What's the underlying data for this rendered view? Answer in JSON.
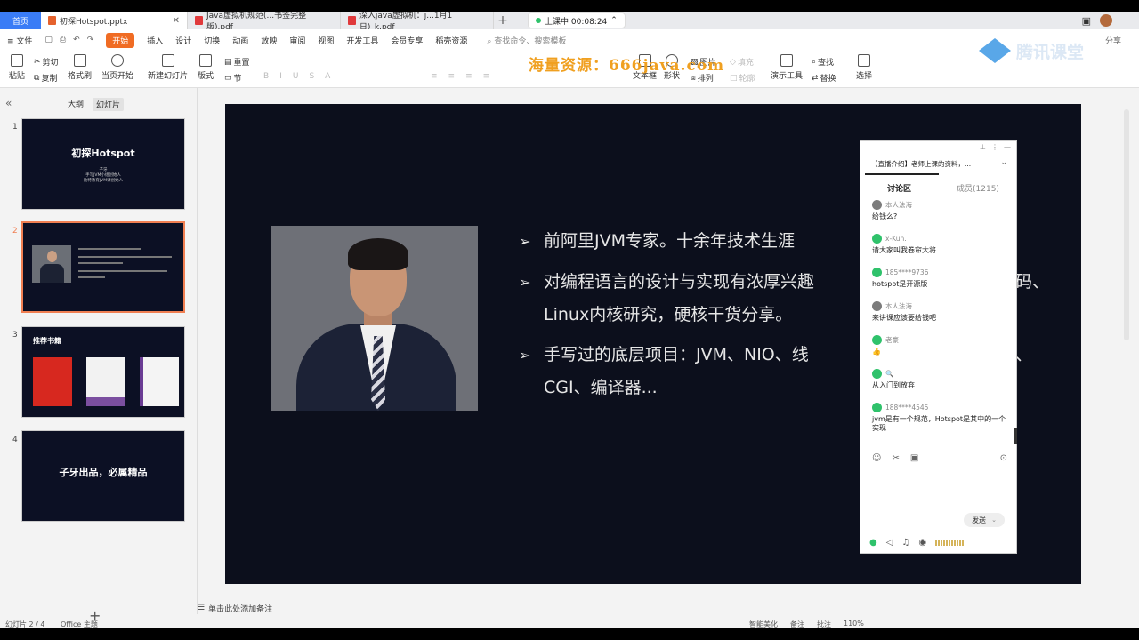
{
  "tabs": {
    "home": "首页",
    "docs": [
      {
        "label": "初探Hotspot.pptx",
        "type": "ppt",
        "active": true
      },
      {
        "label": "Java虚拟机规范(...书签完整版).pdf",
        "type": "pdf",
        "active": false
      },
      {
        "label": "深入java虚拟机：j...1月1日)_k.pdf",
        "type": "pdf",
        "active": false
      }
    ],
    "live_status": "上课中 00:08:24"
  },
  "menubar": {
    "file": "文件",
    "items": [
      "开始",
      "插入",
      "设计",
      "切换",
      "动画",
      "放映",
      "审阅",
      "视图",
      "开发工具",
      "会员专享",
      "稻壳资源"
    ],
    "active": "开始",
    "search": "查找命令、搜索模板",
    "share": "分享"
  },
  "ribbon": {
    "paste": "粘贴",
    "cut": "剪切",
    "copy": "复制",
    "format_painter": "格式刷",
    "from_current": "当页开始",
    "new_slide": "新建幻灯片",
    "layout": "版式",
    "section": "节",
    "reset": "重置",
    "fill": "填充",
    "outline": "轮廓",
    "text_box": "文本框",
    "shape": "形状",
    "picture": "图片",
    "arrange": "排列",
    "present_tools": "演示工具",
    "find": "查找",
    "replace": "替换",
    "select": "选择"
  },
  "watermark": "海量资源：666java.com",
  "brand": "腾讯课堂",
  "left_panel": {
    "tab_outline": "大纲",
    "tab_slides": "幻灯片",
    "slides": [
      {
        "num": "1",
        "title": "初探Hotspot",
        "lines": [
          "子牙",
          "手写JVM小组创始人",
          "比特教育JVM课创始人"
        ]
      },
      {
        "num": "2"
      },
      {
        "num": "3",
        "title": "推荐书籍"
      },
      {
        "num": "4",
        "title": "子牙出品，必属精品"
      }
    ]
  },
  "slide": {
    "bullets": [
      [
        "前阿里JVM专家。十余年技术生涯"
      ],
      [
        "对编程语言的设计与实现有浓厚兴趣",
        "Linux内核研究，硬核干货分享。"
      ],
      [
        "手写过的底层项目：JVM、NIO、线",
        "CGI、编译器..."
      ]
    ],
    "overflow_right_1": "码、",
    "overflow_right_2": "、"
  },
  "chat": {
    "notice": "【直播介绍】老师上课的资料，...",
    "tab_discussion": "讨论区",
    "tab_members": "成员(1215)",
    "messages": [
      {
        "user": "本人法海",
        "text": "给钱么?",
        "icon": "gray"
      },
      {
        "user": "x-Kun.",
        "text": "请大家叫我卷帘大将",
        "icon": "green"
      },
      {
        "user": "185****9736",
        "text": "hotspot是开源版",
        "icon": "green"
      },
      {
        "user": "本人法海",
        "text": "来讲课应该要给钱吧",
        "icon": "gray"
      },
      {
        "user": "老豪",
        "text": "👍",
        "icon": "green"
      },
      {
        "user": "🔍",
        "text": "从入门到放弃",
        "icon": "green"
      },
      {
        "user": "188****4545",
        "text": "jvm是有一个规范，Hotspot是其中的一个实现",
        "icon": "green"
      }
    ],
    "send": "发送"
  },
  "notes_placeholder": "单击此处添加备注",
  "status": {
    "slide_indicator": "幻灯片 2 / 4",
    "theme": "Office 主题",
    "smart_beautify": "智能美化",
    "notes": "备注",
    "annotate": "批注",
    "zoom": "110%"
  }
}
